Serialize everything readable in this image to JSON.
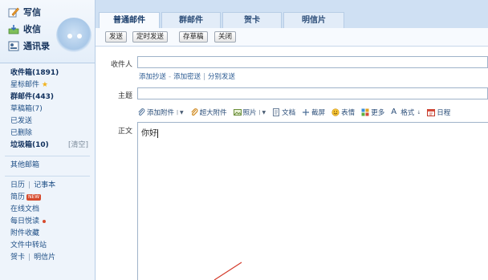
{
  "sidebar": {
    "actions": [
      {
        "label": "写信",
        "icon": "compose-icon"
      },
      {
        "label": "收信",
        "icon": "inbox-icon"
      },
      {
        "label": "通讯录",
        "icon": "address-book-icon"
      }
    ],
    "folders": [
      {
        "label": "收件箱(1891)",
        "bold": true
      },
      {
        "label": "星标邮件",
        "star": true
      },
      {
        "label": "群邮件(443)",
        "bold": true
      },
      {
        "label": "草稿箱(7)"
      },
      {
        "label": "已发送"
      },
      {
        "label": "已删除"
      },
      {
        "label": "垃圾箱(10)",
        "bold": true,
        "extra": "[清空]"
      }
    ],
    "other_mailbox": "其他邮箱",
    "calendar": "日历",
    "notes": "记事本",
    "resume": "简历",
    "new_badge": "NEW",
    "online_docs": "在线文档",
    "daily_read": "每日悦读",
    "attachments": "附件收藏",
    "file_transfer": "文件中转站",
    "greeting_card": "贺卡",
    "postcard": "明信片"
  },
  "tabs": [
    "普通邮件",
    "群邮件",
    "贺卡",
    "明信片"
  ],
  "toolbar": {
    "send": "发送",
    "scheduled": "定时发送",
    "save_draft": "存草稿",
    "close": "关闭"
  },
  "compose": {
    "to_label": "收件人",
    "to_value": "",
    "add_cc": "添加抄送",
    "add_bcc": "添加密送",
    "separate_send": "分别发送",
    "subject_label": "主题",
    "subject_value": "",
    "body_label": "正文",
    "body_text": "你好"
  },
  "format_tools": {
    "attach": "添加附件",
    "big_attach": "超大附件",
    "photo": "照片",
    "doc": "文档",
    "screenshot": "截屏",
    "emoji": "表情",
    "more": "更多",
    "format": "格式",
    "schedule": "日程"
  }
}
